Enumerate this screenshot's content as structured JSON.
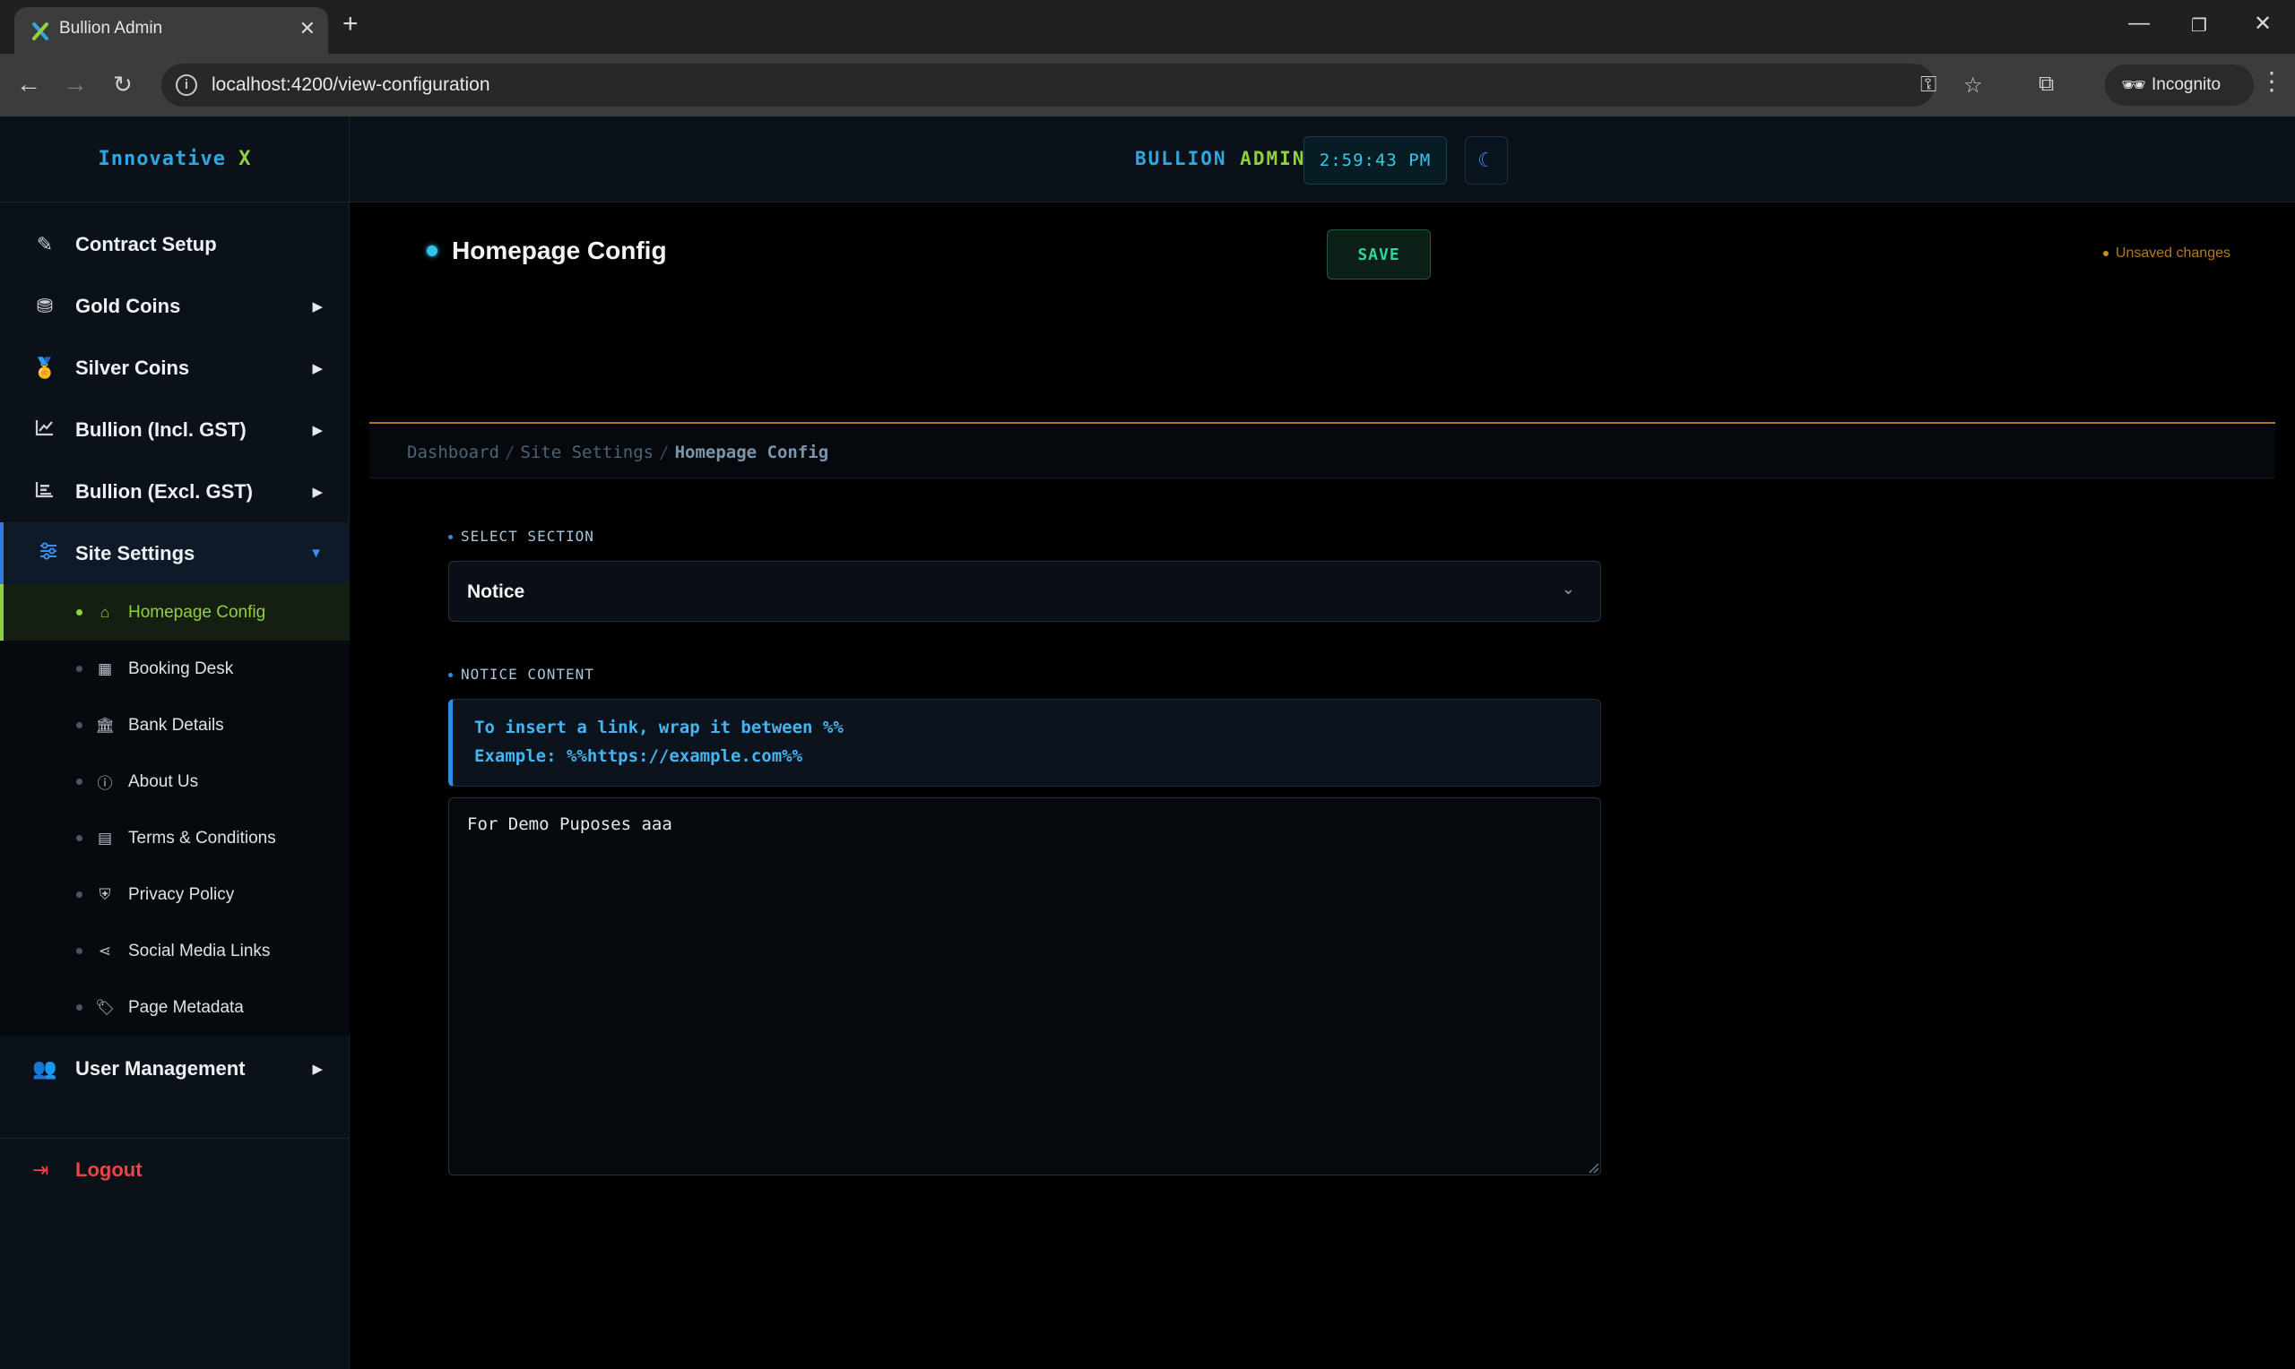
{
  "browser": {
    "tab_title": "Bullion Admin",
    "url": "localhost:4200/view-configuration",
    "incognito_label": "Incognito",
    "icons": {
      "favicon": "x-logo-icon",
      "back": "arrow-left-icon",
      "forward": "arrow-right-icon",
      "reload": "reload-icon",
      "key": "key-icon",
      "bookmark": "star-icon",
      "tab_search": "tab-search-icon",
      "incognito": "incognito-icon"
    }
  },
  "sidebar": {
    "brand_main": "Innovative",
    "brand_accent": "X",
    "items": [
      {
        "label": "Contract Setup",
        "icon": "edit-icon",
        "has_arrow": false
      },
      {
        "label": "Gold Coins",
        "icon": "coins-icon",
        "has_arrow": true
      },
      {
        "label": "Silver Coins",
        "icon": "medal-icon",
        "has_arrow": true
      },
      {
        "label": "Bullion (Incl. GST)",
        "icon": "line-chart-icon",
        "has_arrow": true
      },
      {
        "label": "Bullion (Excl. GST)",
        "icon": "bar-chart-icon",
        "has_arrow": true
      },
      {
        "label": "Site Settings",
        "icon": "sliders-icon",
        "has_arrow": true,
        "active": true
      }
    ],
    "sub_items": [
      {
        "label": "Homepage Config",
        "icon": "home-icon",
        "active": true
      },
      {
        "label": "Booking Desk",
        "icon": "calendar-icon"
      },
      {
        "label": "Bank Details",
        "icon": "bank-icon"
      },
      {
        "label": "About Us",
        "icon": "info-icon"
      },
      {
        "label": "Terms & Conditions",
        "icon": "document-icon"
      },
      {
        "label": "Privacy Policy",
        "icon": "shield-icon"
      },
      {
        "label": "Social Media Links",
        "icon": "share-icon"
      },
      {
        "label": "Page Metadata",
        "icon": "tags-icon"
      }
    ],
    "user_management": {
      "label": "User Management",
      "icon": "users-icon"
    },
    "logout": {
      "label": "Logout",
      "icon": "logout-icon"
    }
  },
  "header": {
    "title_a": "BULLION",
    "title_b": "ADMIN",
    "clock": "2:59:43 PM",
    "theme_icon": "moon-icon"
  },
  "page": {
    "title": "Homepage Config",
    "save_label": "SAVE",
    "unsaved_label": "Unsaved changes",
    "breadcrumb": [
      "Dashboard",
      "Site Settings",
      "Homepage Config"
    ]
  },
  "form": {
    "section_label": "SELECT SECTION",
    "section_value": "Notice",
    "content_label": "NOTICE CONTENT",
    "hint_line1": "To insert a link, wrap it between %%",
    "hint_line2": "Example: %%https://example.com%%",
    "content_value": "For Demo Puposes aaa"
  },
  "colors": {
    "accent_blue": "#2ea8e0",
    "accent_green": "#8fd13f",
    "save_green": "#34d399",
    "warning": "#b07a22",
    "danger": "#ef4444"
  }
}
